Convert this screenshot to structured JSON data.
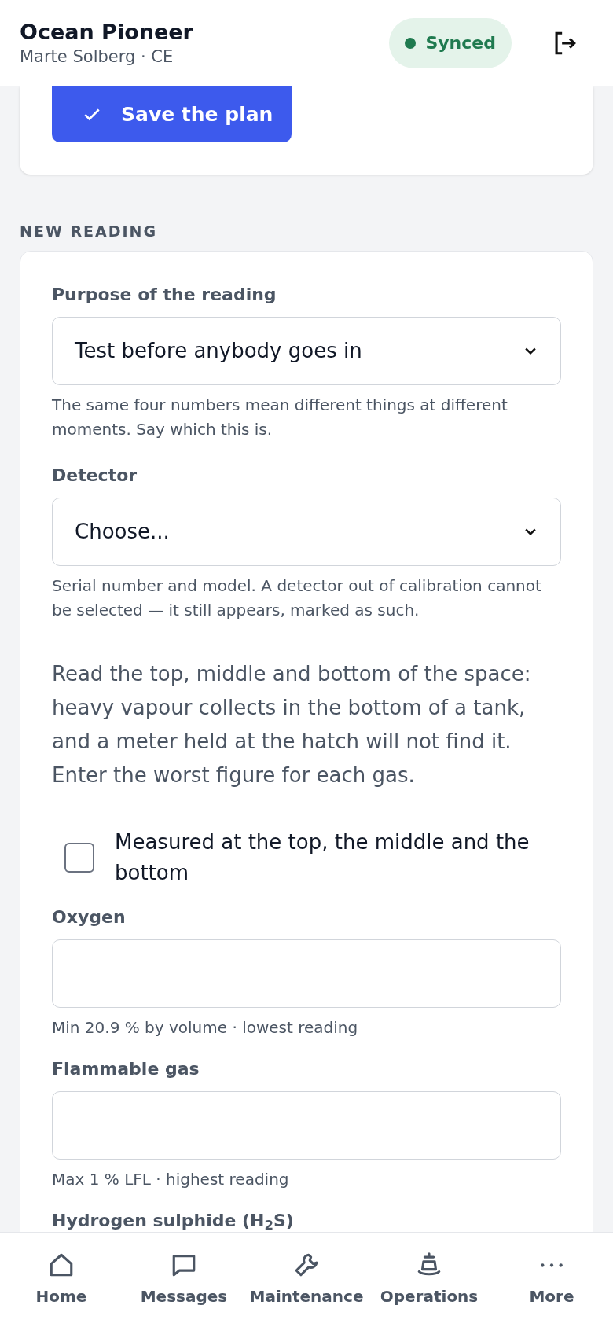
{
  "header": {
    "title": "Ocean Pioneer",
    "subtitle": "Marte Solberg · CE",
    "sync_label": "Synced"
  },
  "plan_card": {
    "save_button": "Save the plan"
  },
  "section_title": "NEW READING",
  "fields": [
    {
      "kind": "select",
      "label": "Purpose of the reading",
      "value": "Test before anybody goes in",
      "help": "The same four numbers mean different things at different moments. Say which this is."
    },
    {
      "kind": "select",
      "label": "Detector",
      "value": "Choose...",
      "help": "Serial number and model. A detector out of calibration cannot be selected — it still appears, marked as such."
    },
    {
      "kind": "note",
      "text": "Read the top, middle and bottom of the space: heavy vapour collects in the bottom of a tank, and a meter held at the hatch will not find it. Enter the worst figure for each gas."
    },
    {
      "kind": "checkbox",
      "label": "Measured at the top, the middle and the bottom",
      "checked": false
    },
    {
      "kind": "input",
      "label": "Oxygen",
      "help": "Min 20.9 % by volume · lowest reading"
    },
    {
      "kind": "input",
      "label": "Flammable gas",
      "help": "Max 1 % LFL · highest reading"
    },
    {
      "kind": "input",
      "label": "Hydrogen sulphide (H$_{2}$S)"
    }
  ],
  "nav": [
    {
      "label": "Home"
    },
    {
      "label": "Messages"
    },
    {
      "label": "Maintenance"
    },
    {
      "label": "Operations"
    },
    {
      "label": "More"
    }
  ]
}
